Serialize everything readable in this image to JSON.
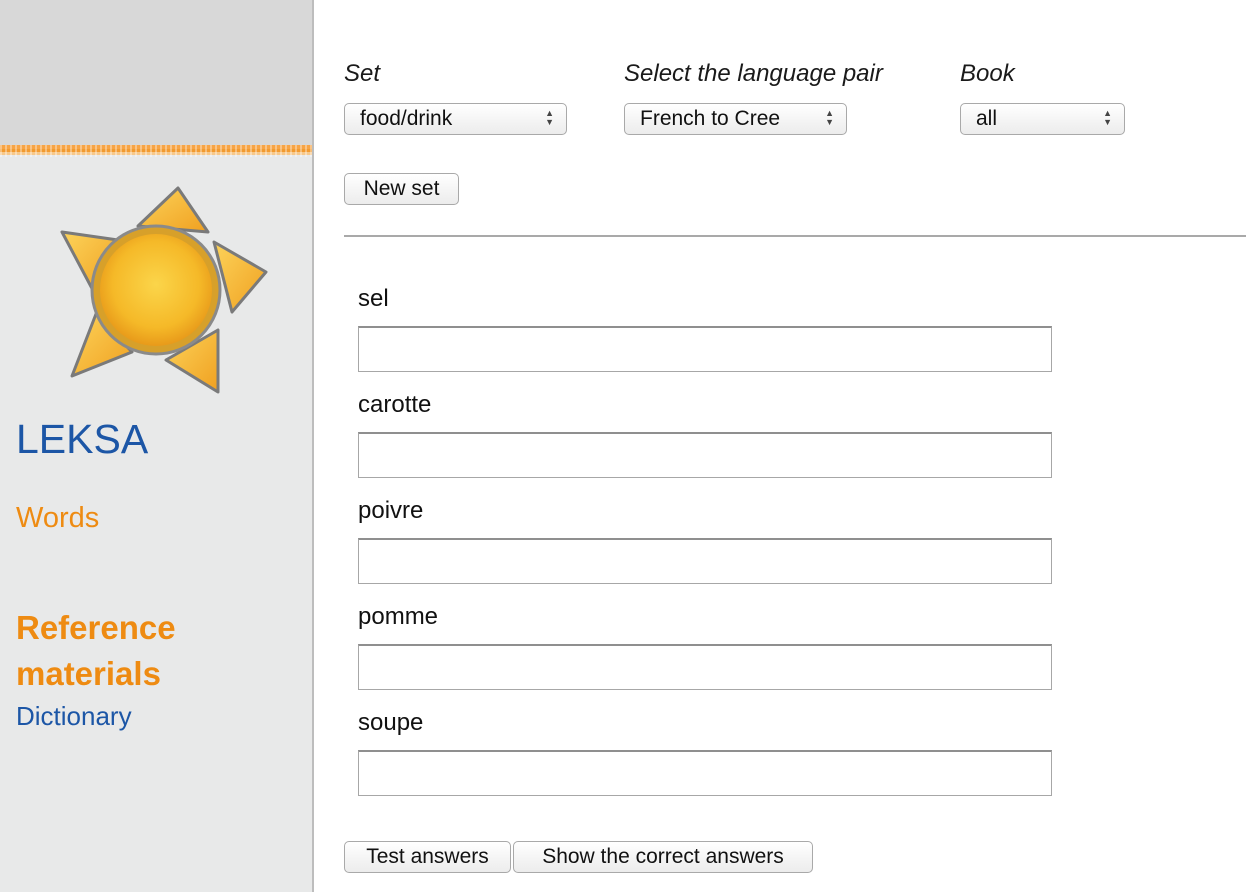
{
  "sidebar": {
    "brand": "LEKSA",
    "nav_words": "Words",
    "reference_heading": "Reference materials",
    "nav_dictionary": "Dictionary",
    "logo_icon": "sun-star-logo-icon"
  },
  "controls": {
    "set_label": "Set",
    "set_value": "food/drink",
    "pair_label": "Select the language pair",
    "pair_value": "French to Cree",
    "book_label": "Book",
    "book_value": "all",
    "new_set_button": "New set"
  },
  "words": [
    {
      "prompt": "sel",
      "answer": ""
    },
    {
      "prompt": "carotte",
      "answer": ""
    },
    {
      "prompt": "poivre",
      "answer": ""
    },
    {
      "prompt": "pomme",
      "answer": ""
    },
    {
      "prompt": "soupe",
      "answer": ""
    }
  ],
  "actions": {
    "test_answers": "Test answers",
    "show_correct": "Show the correct answers"
  },
  "colors": {
    "brand_blue": "#1c56a6",
    "accent_orange": "#ee8b12",
    "sidebar_bg": "#e8e9e9"
  }
}
